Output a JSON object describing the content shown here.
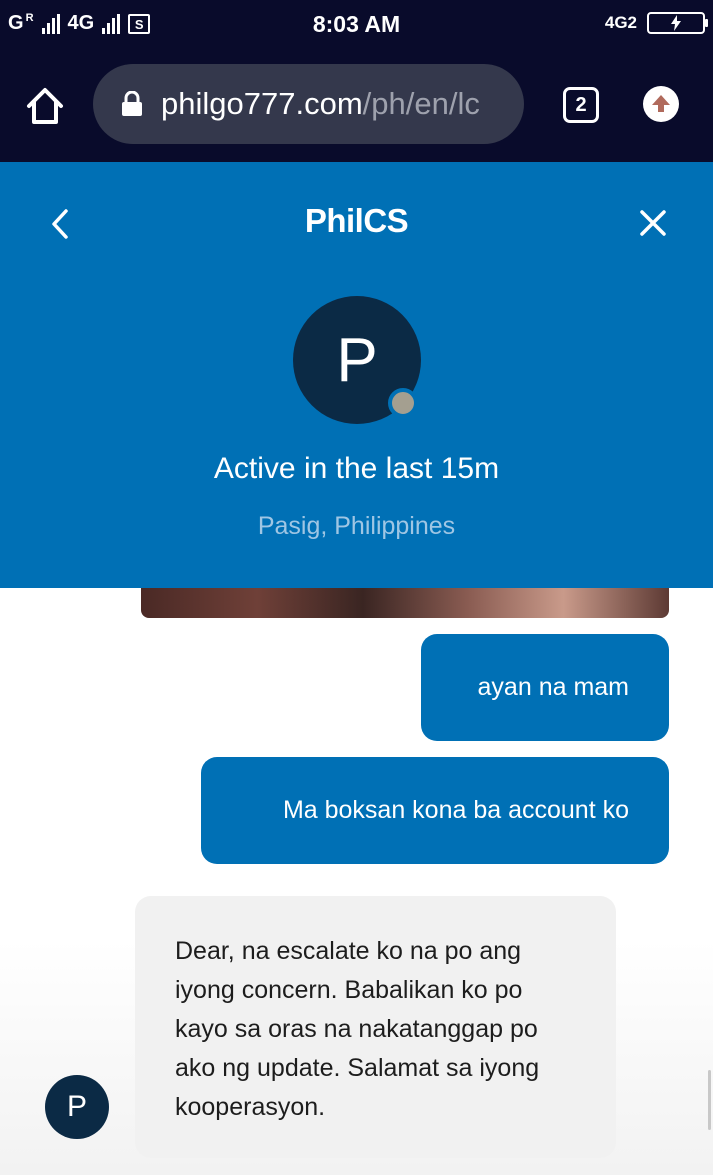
{
  "status_bar": {
    "sim1_label": "G",
    "sim1_roaming": "R",
    "sim2_label": "4G",
    "s_badge": "S",
    "time": "8:03 AM",
    "network_right": "4G2"
  },
  "browser": {
    "url_domain": "philgo777.com",
    "url_path": "/ph/en/lc",
    "tab_count": "2",
    "colors": {
      "toolbar_bg": "#090b2b",
      "url_box_bg": "#34384c"
    }
  },
  "chat_header": {
    "title": "PhilCS",
    "avatar_initial": "P",
    "active_status": "Active in the last 15m",
    "location": "Pasig, Philippines",
    "back_icon": "chevron-left-icon",
    "close_icon": "close-icon",
    "colors": {
      "header_bg": "#0070b5",
      "avatar_bg": "#0b2a45",
      "status_dot": "#a49f90"
    }
  },
  "messages": [
    {
      "sender": "user",
      "text": "ayan na mam"
    },
    {
      "sender": "user",
      "text": "Ma boksan kona ba account ko"
    },
    {
      "sender": "agent",
      "text": "Dear, na escalate ko na po ang iyong concern. Babalikan ko po kayo sa oras na nakatanggap po ako ng update. Salamat sa iyong kooperasyon."
    }
  ],
  "agent": {
    "avatar_initial": "P"
  }
}
